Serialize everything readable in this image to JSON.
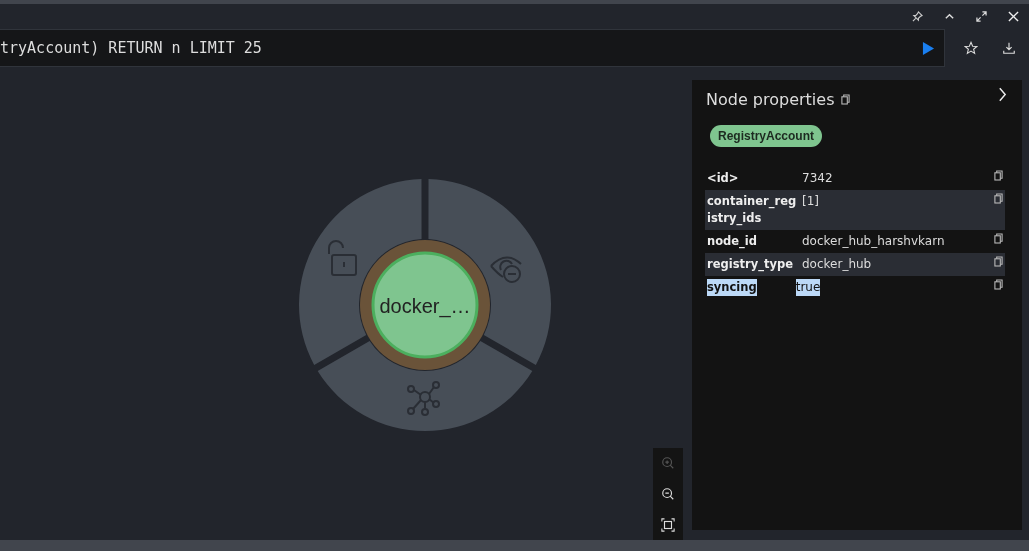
{
  "window_controls": [
    {
      "kind": "pin"
    },
    {
      "kind": "collapse"
    },
    {
      "kind": "expand"
    },
    {
      "kind": "close"
    }
  ],
  "query": {
    "text": "tryAccount) RETURN n LIMIT 25"
  },
  "query_actions": [
    {
      "kind": "star"
    },
    {
      "kind": "download"
    }
  ],
  "graph": {
    "node": {
      "caption": "docker_…",
      "color": "#7fc58f"
    },
    "menu": [
      {
        "kind": "unlock"
      },
      {
        "kind": "hide"
      },
      {
        "kind": "expand"
      }
    ]
  },
  "zoom_controls": [
    {
      "kind": "zoom_in",
      "disabled": true
    },
    {
      "kind": "zoom_out",
      "disabled": false
    },
    {
      "kind": "fit",
      "disabled": false
    }
  ],
  "panel": {
    "title": "Node properties",
    "label": {
      "text": "RegistryAccount",
      "color": "#7fc58f"
    },
    "properties": [
      {
        "key": "<id>",
        "value": "7342",
        "selected": false
      },
      {
        "key": "container_registry_ids",
        "value": "[1]",
        "selected": false
      },
      {
        "key": "node_id",
        "value": "docker_hub_harshvkarn",
        "selected": false
      },
      {
        "key": "registry_type",
        "value": "docker_hub",
        "selected": false
      },
      {
        "key": "syncing",
        "value": "true",
        "selected": true
      }
    ]
  }
}
